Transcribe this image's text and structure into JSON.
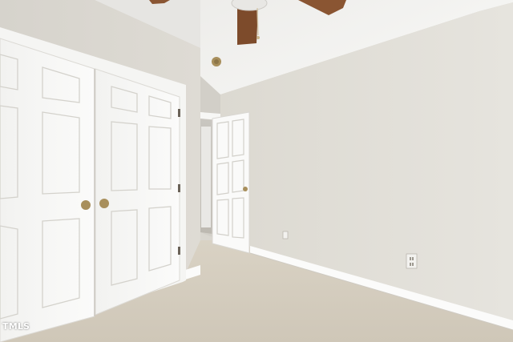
{
  "photo": {
    "subject": "empty-bedroom",
    "watermark": "TMLS",
    "colors": {
      "ceiling": "#f1f0ee",
      "right_wall": "#e2dfd8",
      "left_wall": "#dcd9d2",
      "carpet": "#d6cfc2",
      "door_white": "#f7f7f5",
      "trim": "#fbfbfa",
      "fan_wood": "#8a5532",
      "brass": "#a88f5c"
    }
  }
}
